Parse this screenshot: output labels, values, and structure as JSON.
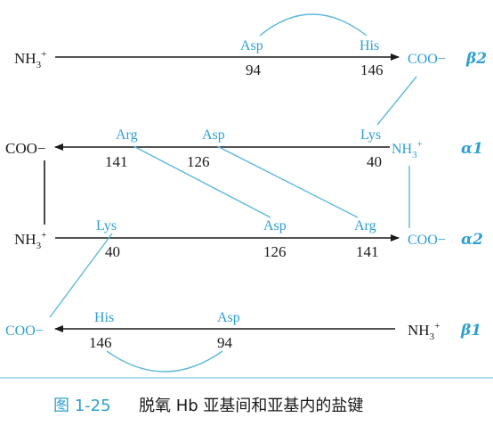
{
  "chains": [
    {
      "subunit": "β2",
      "start": "NH3+",
      "end": "COO−",
      "residues": [
        {
          "name": "Asp",
          "num": "94"
        },
        {
          "name": "His",
          "num": "146"
        }
      ]
    },
    {
      "subunit": "α1",
      "start": "NH3+",
      "end": "COO−",
      "residues": [
        {
          "name": "Arg",
          "num": "141"
        },
        {
          "name": "Asp",
          "num": "126"
        },
        {
          "name": "Lys",
          "num": "40"
        }
      ]
    },
    {
      "subunit": "α2",
      "start": "NH3+",
      "end": "COO−",
      "residues": [
        {
          "name": "Lys",
          "num": "40"
        },
        {
          "name": "Asp",
          "num": "126"
        },
        {
          "name": "Arg",
          "num": "141"
        }
      ]
    },
    {
      "subunit": "β1",
      "start": "NH3+",
      "end": "COO−",
      "residues": [
        {
          "name": "His",
          "num": "146"
        },
        {
          "name": "Asp",
          "num": "94"
        }
      ]
    }
  ],
  "caption": {
    "figure_number": "图 1-25",
    "text": "脱氧 Hb 亚基间和亚基内的盐键"
  },
  "colors": {
    "chain": "#1a1a1a",
    "bridge": "#5fb8dd",
    "accent": "#2f9fd0"
  }
}
